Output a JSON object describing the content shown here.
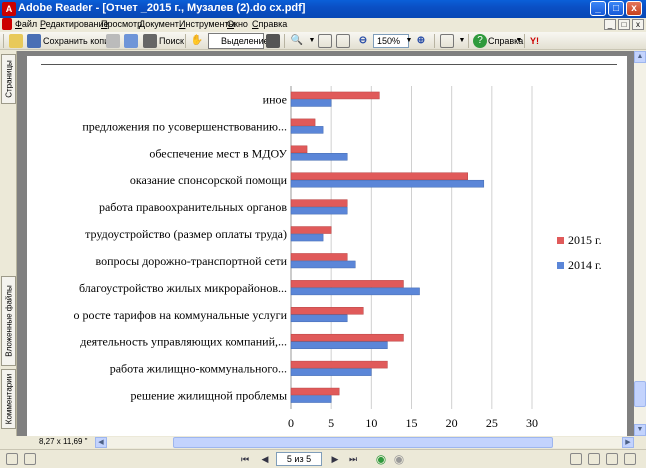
{
  "window": {
    "app_icon": "adobe-reader-icon",
    "title": "Adobe Reader - [Отчет _2015 г., Музалев (2).do cx.pdf]",
    "controls": [
      "_",
      "□",
      "x"
    ]
  },
  "menu": {
    "items": [
      "Файл",
      "Редактирование",
      "Просмотр",
      "Документ",
      "Инструменты",
      "Окно",
      "Справка"
    ]
  },
  "toolbar": {
    "save_copy": "Сохранить копию",
    "search": "Поиск",
    "select": "Выделение",
    "zoom_value": "150%",
    "help": "Справка",
    "yahoo": "Y!"
  },
  "leftnav": {
    "pages_tab": "Страницы",
    "attachments_tab": "Вложенные файлы",
    "comments_tab": "Комментарии"
  },
  "page_size_label": "8,27 x 11,69 \"",
  "status": {
    "page_display": "5 из 5"
  },
  "colors": {
    "series_2015": "#e05a5a",
    "series_2014": "#5b86d8"
  },
  "chart_data": {
    "type": "bar",
    "orientation": "horizontal",
    "categories": [
      "иное",
      "предложения по усовершенствованию...",
      "обеспечение мест в МДОУ",
      "оказание спонсорской помощи",
      "работа правоохранительных органов",
      "трудоустройство (размер оплаты труда)",
      "вопросы дорожно-транспортной сети",
      "благоустройство жилых микрорайонов...",
      "о росте тарифов на коммунальные услуги",
      "деятельность управляющих компаний,...",
      "работа жилищно-коммунального...",
      "решение жилищной проблемы"
    ],
    "series": [
      {
        "name": "2015 г.",
        "values": [
          11,
          3,
          2,
          22,
          7,
          5,
          7,
          14,
          9,
          14,
          12,
          6
        ]
      },
      {
        "name": "2014 г.",
        "values": [
          5,
          4,
          7,
          24,
          7,
          4,
          8,
          16,
          7,
          12,
          10,
          5
        ]
      }
    ],
    "xlim": [
      0,
      30
    ],
    "xticks": [
      0,
      5,
      10,
      15,
      20,
      25,
      30
    ],
    "grid": true,
    "legend": "right"
  }
}
